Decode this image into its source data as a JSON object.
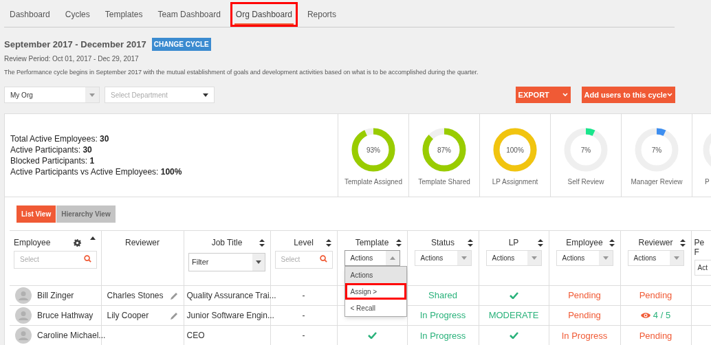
{
  "tabs": [
    {
      "label": "Dashboard",
      "selected": false,
      "annotated": false
    },
    {
      "label": "Cycles",
      "selected": false,
      "annotated": false
    },
    {
      "label": "Templates",
      "selected": false,
      "annotated": false
    },
    {
      "label": "Team Dashboard",
      "selected": false,
      "annotated": false
    },
    {
      "label": "Org Dashboard",
      "selected": true,
      "annotated": true
    },
    {
      "label": "Reports",
      "selected": false,
      "annotated": false
    }
  ],
  "cycle": {
    "title": "September 2017 - December 2017",
    "change_button": "CHANGE CYCLE",
    "review_period": "Review Period: Oct 01, 2017 - Dec 29, 2017",
    "description": "The Performance cycle begins in September 2017 with the mutual establishment of goals and development activities based on what is to be accomplished during the quarter."
  },
  "filters": {
    "org": "My Org",
    "department_placeholder": "Select Department"
  },
  "actions": [
    "EXPORT",
    "Add users to this cycle"
  ],
  "stats": [
    "Total Active Employees: **30**",
    "Active Participants: **30**",
    "Blocked Participants: **1**",
    "Active Participants vs Active Employees: **100%**"
  ],
  "meters": [
    {
      "kind": "full",
      "label": "Template Assigned",
      "reading": "93%",
      "level": 0.93,
      "color": "#99cc00"
    },
    {
      "kind": "full",
      "label": "Template Shared",
      "reading": "87%",
      "level": 0.87,
      "color": "#99cc00"
    },
    {
      "kind": "full",
      "label": "LP Assignment",
      "reading": "100%",
      "level": 1,
      "color": "#f1c40f"
    },
    {
      "kind": "full",
      "label": "Self Review",
      "reading": "7%",
      "level": 0.07,
      "color": "#19e68c"
    },
    {
      "kind": "full",
      "label": "Manager Review",
      "reading": "7%",
      "level": 0.07,
      "color": "#3d8ef0"
    },
    {
      "kind": "cut",
      "label": "P"
    }
  ],
  "views": [
    {
      "label": "List View",
      "selected": true
    },
    {
      "label": "Hierarchy View",
      "selected": false
    }
  ],
  "table": {
    "columns": [
      {
        "label": "Employee",
        "gear": true,
        "sortable": false,
        "sorted": true,
        "filter": {
          "kind": "search",
          "placeholder": "Select"
        }
      },
      {
        "label": "Reviewer",
        "gear": false,
        "sortable": false,
        "sorted": false
      },
      {
        "label": "Job Title",
        "gear": false,
        "sortable": true,
        "sorted": false,
        "filter": {
          "kind": "select",
          "value": "Filter"
        }
      },
      {
        "label": "Level",
        "gear": false,
        "sortable": true,
        "sorted": false,
        "filter": {
          "kind": "search",
          "placeholder": "Select"
        }
      },
      {
        "label": "Template",
        "gear": false,
        "sortable": true,
        "sorted": false,
        "filter": {
          "kind": "actions",
          "value": "Actions",
          "expanded": true,
          "options": [
            {
              "label": "Actions",
              "selected": true,
              "annotated": false
            },
            {
              "label": "Assign >",
              "selected": false,
              "annotated": true
            },
            {
              "label": "< Recall",
              "selected": false,
              "annotated": false
            }
          ]
        }
      },
      {
        "label": "Status",
        "gear": false,
        "sortable": true,
        "sorted": false,
        "filter": {
          "kind": "actions",
          "value": "Actions",
          "expanded": false
        }
      },
      {
        "label": "LP",
        "gear": false,
        "sortable": true,
        "sorted": false,
        "filter": {
          "kind": "actions",
          "value": "Actions",
          "expanded": false
        }
      },
      {
        "label": "Employee",
        "gear": false,
        "sortable": true,
        "sorted": false,
        "filter": {
          "kind": "actions",
          "value": "Actions",
          "expanded": false
        }
      },
      {
        "label": "Reviewer",
        "gear": false,
        "sortable": true,
        "sorted": false,
        "filter": {
          "kind": "actions",
          "value": "Actions",
          "expanded": false
        }
      },
      {
        "label": "Pe\nF",
        "gear": false,
        "sortable": false,
        "sorted": false,
        "filter": {
          "kind": "cut",
          "value": "Act"
        }
      }
    ],
    "rows": [
      [
        {
          "kind": "person",
          "text": "Bill Zinger"
        },
        {
          "kind": "editable",
          "text": "Charles Stones"
        },
        {
          "kind": "text",
          "text": "Quality Assurance Trai..."
        },
        {
          "kind": "text",
          "text": "-"
        },
        {
          "kind": "empty"
        },
        {
          "kind": "status",
          "text": "Shared",
          "color": "#2ab27b"
        },
        {
          "kind": "check",
          "color": "#2ab27b"
        },
        {
          "kind": "status",
          "text": "Pending",
          "color": "#f05a35"
        },
        {
          "kind": "status",
          "text": "Pending",
          "color": "#f05a35"
        },
        {
          "kind": "empty"
        }
      ],
      [
        {
          "kind": "person",
          "text": "Bruce Hathway"
        },
        {
          "kind": "editable",
          "text": "Lily Cooper"
        },
        {
          "kind": "text",
          "text": "Junior Software Engin..."
        },
        {
          "kind": "text",
          "text": "-"
        },
        {
          "kind": "empty"
        },
        {
          "kind": "status",
          "text": "In Progress",
          "color": "#2ab27b"
        },
        {
          "kind": "status",
          "text": "MODERATE",
          "color": "#2ab27b"
        },
        {
          "kind": "status",
          "text": "Pending",
          "color": "#f05a35"
        },
        {
          "kind": "views",
          "text": "4 / 5",
          "color": "#2ab27b"
        },
        {
          "kind": "empty"
        }
      ],
      [
        {
          "kind": "person",
          "text": "Caroline Michael..."
        },
        {
          "kind": "empty"
        },
        {
          "kind": "text",
          "text": "CEO"
        },
        {
          "kind": "text",
          "text": "-"
        },
        {
          "kind": "check",
          "color": "#2ab27b"
        },
        {
          "kind": "status",
          "text": "In Progress",
          "color": "#2ab27b"
        },
        {
          "kind": "check",
          "color": "#2ab27b"
        },
        {
          "kind": "status",
          "text": "In Progress",
          "color": "#f05a35"
        },
        {
          "kind": "status",
          "text": "Pending",
          "color": "#f05a35"
        },
        {
          "kind": "empty"
        }
      ]
    ]
  }
}
